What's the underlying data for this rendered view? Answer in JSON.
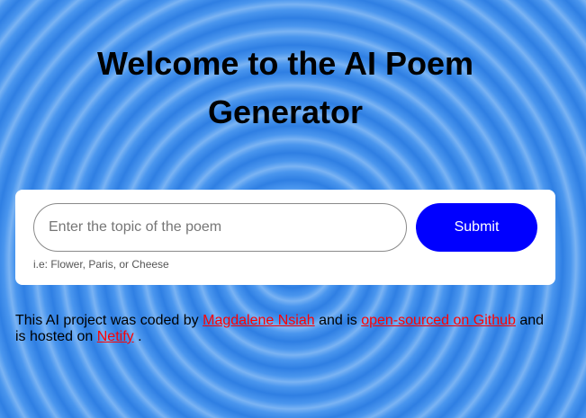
{
  "header": {
    "title": "Welcome to the AI Poem Generator"
  },
  "form": {
    "input_placeholder": "Enter the topic of the poem",
    "input_value": "",
    "submit_label": "Submit",
    "hint": "i.e: Flower, Paris, or Cheese"
  },
  "footer": {
    "text_1": "This AI project was coded by ",
    "author_link": "Magdalene Nsiah",
    "text_2": " and is ",
    "github_link": "open-sourced on Github",
    "text_3": " and is hosted on ",
    "netlify_link": "Netify",
    "text_4": " ."
  },
  "colors": {
    "background": "#3a8bea",
    "submit_button": "#0000ff",
    "link": "#ff0000"
  }
}
